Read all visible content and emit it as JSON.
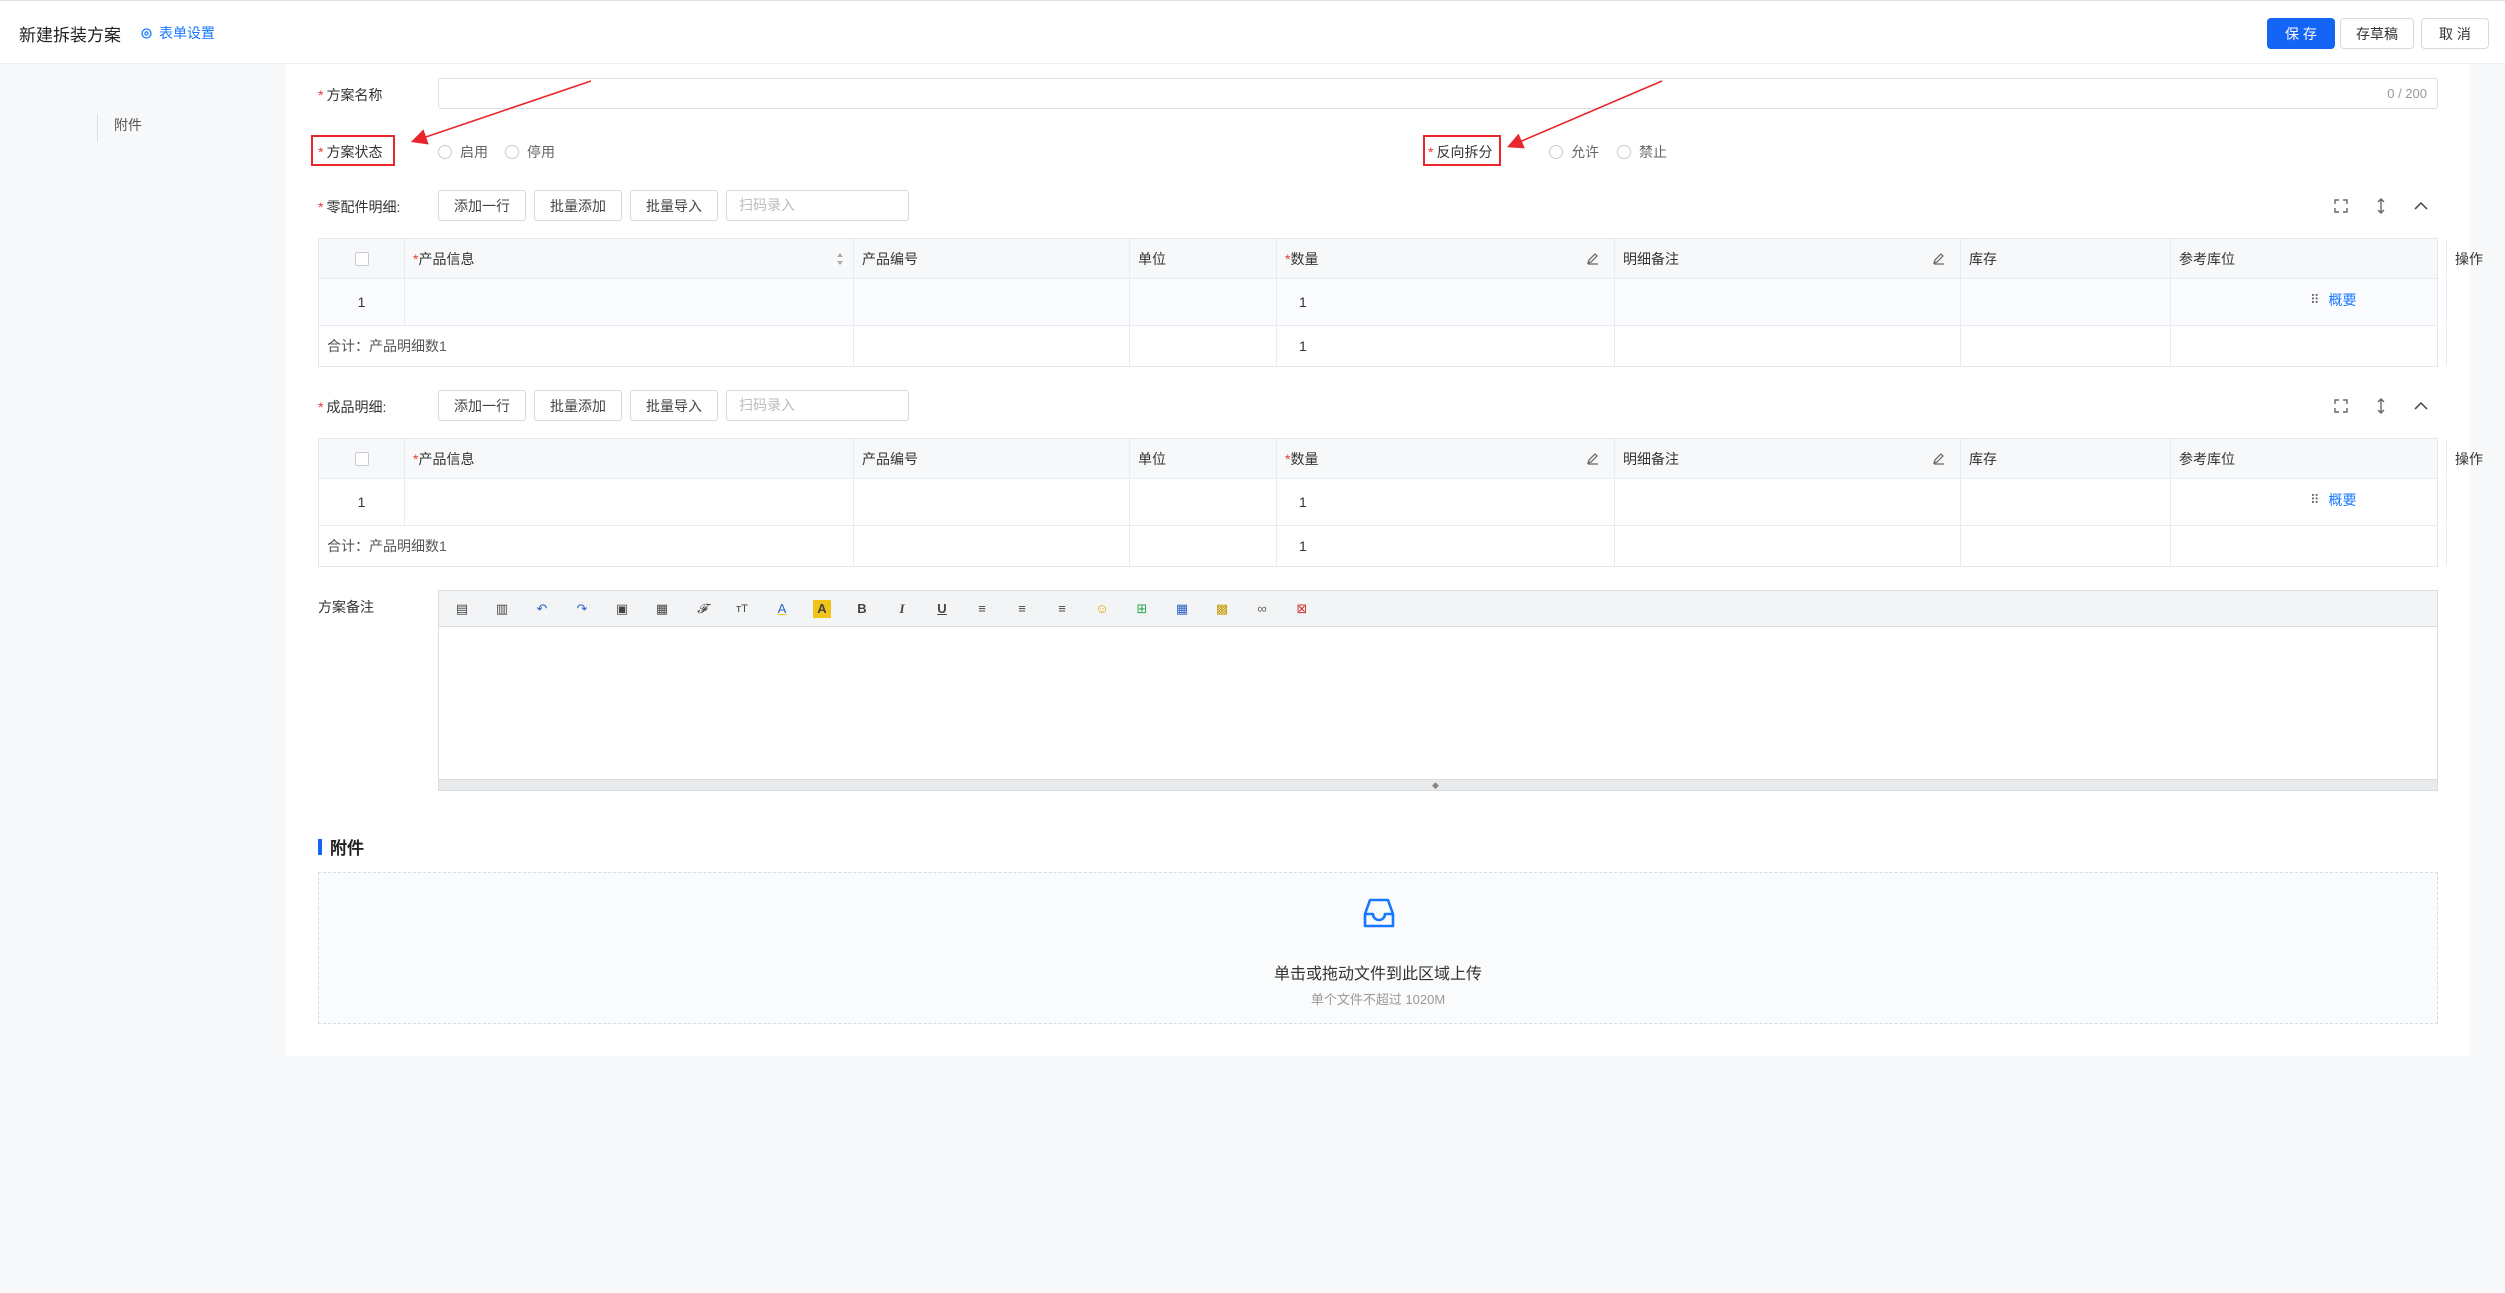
{
  "header": {
    "title": "新建拆装方案",
    "form_settings": "表单设置",
    "save": "保 存",
    "draft": "存草稿",
    "cancel": "取 消"
  },
  "sidebar": {
    "items": [
      {
        "label": "附件"
      }
    ]
  },
  "form": {
    "name_label": "方案名称",
    "name_count": "0 / 200",
    "status_label": "方案状态",
    "status_options": [
      "启用",
      "停用"
    ],
    "reverse_label": "反向拆分",
    "reverse_options": [
      "允许",
      "禁止"
    ],
    "remark_label": "方案备注"
  },
  "parts": {
    "label": "零配件明细:",
    "buttons": [
      "添加一行",
      "批量添加",
      "批量导入"
    ],
    "scan_placeholder": "扫码录入",
    "columns": [
      "产品信息",
      "产品编号",
      "单位",
      "数量",
      "明细备注",
      "库存",
      "参考库位",
      "操作"
    ],
    "rows": [
      {
        "index": "1",
        "qty": "1",
        "action": "概要"
      }
    ],
    "summary": {
      "label": "合计：产品明细数1",
      "qty": "1"
    }
  },
  "products": {
    "label": "成品明细:",
    "buttons": [
      "添加一行",
      "批量添加",
      "批量导入"
    ],
    "scan_placeholder": "扫码录入",
    "columns": [
      "产品信息",
      "产品编号",
      "单位",
      "数量",
      "明细备注",
      "库存",
      "参考库位",
      "操作"
    ],
    "rows": [
      {
        "index": "1",
        "qty": "1",
        "action": "概要"
      }
    ],
    "summary": {
      "label": "合计：产品明细数1",
      "qty": "1"
    }
  },
  "attachment": {
    "title": "附件",
    "upload_text": "单击或拖动文件到此区域上传",
    "upload_hint": "单个文件不超过 1020M"
  },
  "colors": {
    "primary": "#1464f5",
    "link": "#1677ff",
    "annotation_red": "#e8262b"
  }
}
